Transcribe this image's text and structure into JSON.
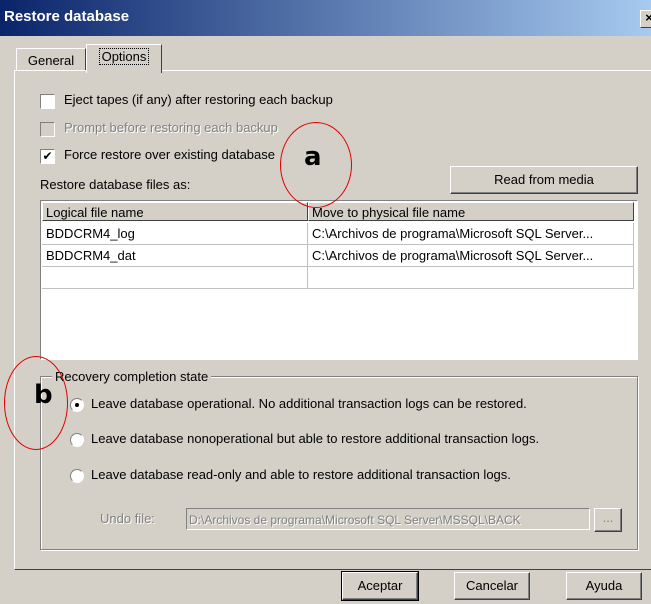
{
  "window": {
    "title": "Restore database",
    "close_glyph": "×"
  },
  "tabs": [
    {
      "label": "General"
    },
    {
      "label": "Options"
    }
  ],
  "options": {
    "eject": {
      "label": "Eject tapes (if any) after restoring each backup",
      "checked": false
    },
    "prompt": {
      "label": "Prompt before restoring each backup",
      "checked": false,
      "disabled": true
    },
    "force": {
      "label": "Force restore over existing database",
      "checked": true,
      "check_glyph": "✔"
    },
    "files_label": "Restore database files as:",
    "read_from_media": "Read from media"
  },
  "files_table": {
    "headers": [
      "Logical file name",
      "Move to physical file name"
    ],
    "rows": [
      {
        "logical": "BDDCRM4_log",
        "physical": "C:\\Archivos de programa\\Microsoft SQL Server..."
      },
      {
        "logical": "BDDCRM4_dat",
        "physical": "C:\\Archivos de programa\\Microsoft SQL Server..."
      }
    ]
  },
  "recovery": {
    "title": "Recovery completion state",
    "options": [
      {
        "label": "Leave database operational. No additional transaction logs can be restored.",
        "selected": true
      },
      {
        "label": "Leave database nonoperational but able to restore additional transaction logs.",
        "selected": false
      },
      {
        "label": "Leave database read-only and able to restore additional transaction logs.",
        "selected": false
      }
    ],
    "undo_label": "Undo file:",
    "undo_value": "D:\\Archivos de programa\\Microsoft SQL Server\\MSSQL\\BACK",
    "browse_label": "..."
  },
  "buttons": {
    "ok": "Aceptar",
    "cancel": "Cancelar",
    "help": "Ayuda"
  },
  "annotations": [
    {
      "letter": "a",
      "color": "#e00000"
    },
    {
      "letter": "b",
      "color": "#e00000"
    }
  ]
}
